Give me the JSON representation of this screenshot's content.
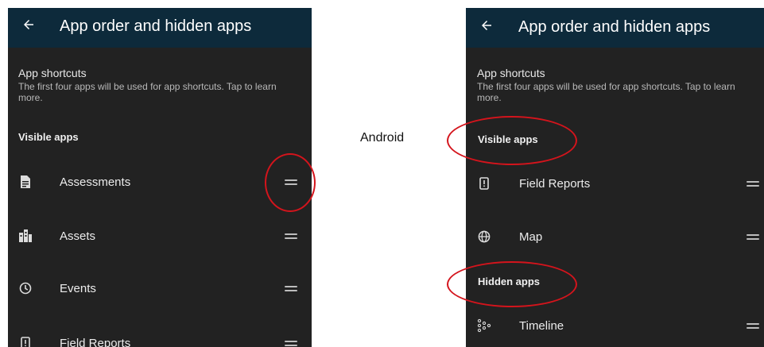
{
  "left_screen": {
    "title": "App order and hidden apps",
    "shortcuts": {
      "title": "App shortcuts",
      "description": "The first four apps will be used for app shortcuts. Tap to learn more."
    },
    "visible_label": "Visible apps",
    "apps": [
      {
        "label": "Assessments",
        "icon": "document-list-icon"
      },
      {
        "label": "Assets",
        "icon": "buildings-icon"
      },
      {
        "label": "Events",
        "icon": "clock-icon"
      },
      {
        "label": "Field Reports",
        "icon": "report-alert-icon"
      }
    ]
  },
  "caption": "Android",
  "right_screen": {
    "title": "App order and hidden apps",
    "shortcuts": {
      "title": "App shortcuts",
      "description": "The first four apps will be used for app shortcuts. Tap to learn more."
    },
    "visible_label": "Visible apps",
    "visible_apps": [
      {
        "label": "Field Reports",
        "icon": "report-alert-icon"
      },
      {
        "label": "Map",
        "icon": "globe-icon"
      }
    ],
    "hidden_label": "Hidden apps",
    "hidden_apps": [
      {
        "label": "Timeline",
        "icon": "timeline-icon"
      }
    ]
  },
  "colors": {
    "appbar": "#0d2a3b",
    "background": "#222222",
    "annotation": "#d4141c"
  }
}
